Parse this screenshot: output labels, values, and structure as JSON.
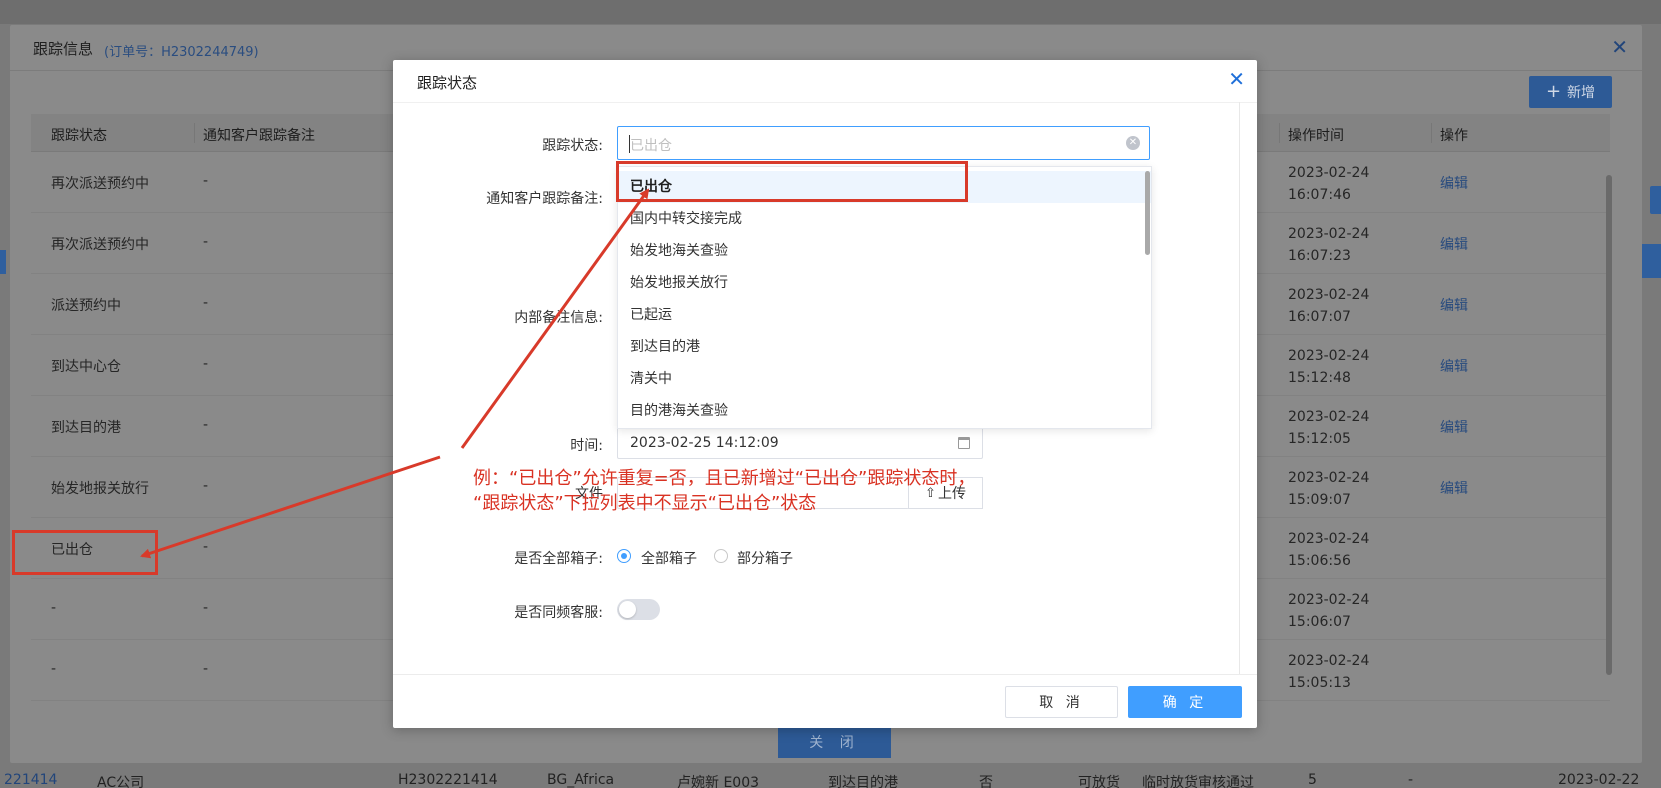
{
  "background_page": {
    "bottom_row": [
      "221414",
      "AC公司",
      "H2302221414",
      "BG_Africa",
      "卢婉新 E003",
      "到达目的港",
      "否",
      "可放货",
      "临时放货审核通过",
      "5",
      "-",
      "2023-02-22"
    ]
  },
  "tracking_dialog": {
    "title": "跟踪信息",
    "order_no": "(订单号：H2302244749)",
    "add_button": "新增",
    "close_button": "关 闭",
    "columns": {
      "status": "跟踪状态",
      "notify_remark": "通知客户跟踪备注",
      "op_time": "操作时间",
      "action": "操作"
    },
    "rows": [
      {
        "status": "再次派送预约中",
        "remark": "-",
        "date": "2023-02-24",
        "time": "16:07:46",
        "action": "编辑"
      },
      {
        "status": "再次派送预约中",
        "remark": "-",
        "date": "2023-02-24",
        "time": "16:07:23",
        "action": "编辑"
      },
      {
        "status": "派送预约中",
        "remark": "-",
        "date": "2023-02-24",
        "time": "16:07:07",
        "action": "编辑"
      },
      {
        "status": "到达中心仓",
        "remark": "-",
        "date": "2023-02-24",
        "time": "15:12:48",
        "action": "编辑"
      },
      {
        "status": "到达目的港",
        "remark": "-",
        "date": "2023-02-24",
        "time": "15:12:05",
        "action": "编辑"
      },
      {
        "status": "始发地报关放行",
        "remark": "-",
        "date": "2023-02-24",
        "time": "15:09:07",
        "action": "编辑"
      },
      {
        "status": "已出仓",
        "remark": "-",
        "date": "2023-02-24",
        "time": "15:06:56",
        "action": ""
      },
      {
        "status": "-",
        "remark": "-",
        "date": "2023-02-24",
        "time": "15:06:07",
        "action": ""
      },
      {
        "status": "-",
        "remark": "-",
        "date": "2023-02-24",
        "time": "15:05:13",
        "action": ""
      }
    ]
  },
  "status_dialog": {
    "title": "跟踪状态",
    "labels": {
      "status": "跟踪状态:",
      "notify_remark": "通知客户跟踪备注:",
      "internal_remark": "内部备注信息:",
      "time": "时间:",
      "file": "文件",
      "all_boxes": "是否全部箱子:",
      "sync_cs": "是否同频客服:"
    },
    "status_placeholder": "已出仓",
    "dropdown_options": [
      "已出仓",
      "国内中转交接完成",
      "始发地海关查验",
      "始发地报关放行",
      "已起运",
      "到达目的港",
      "清关中",
      "目的港海关查验"
    ],
    "time_value": "2023-02-25 14:12:09",
    "upload_label": "上传",
    "radio_all": "全部箱子",
    "radio_partial": "部分箱子",
    "cancel": "取 消",
    "confirm": "确 定"
  },
  "annotation": {
    "line1": "例：“已出仓”允许重复=否，且已新增过“已出仓”跟踪状态时，",
    "line2": "“跟踪状态”下拉列表中不显示“已出仓”状态"
  },
  "colors": {
    "primary": "#409eff",
    "annotation_red": "#d83a2a"
  }
}
